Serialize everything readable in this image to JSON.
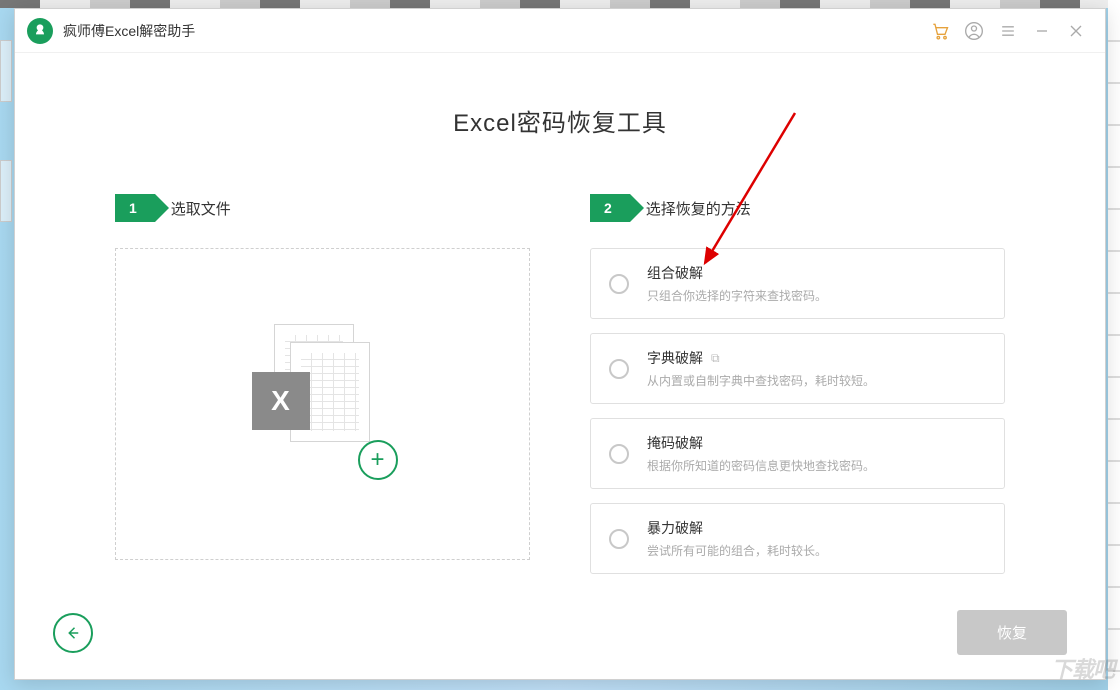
{
  "app": {
    "title": "疯师傅Excel解密助手"
  },
  "page": {
    "title": "Excel密码恢复工具"
  },
  "steps": {
    "step1": {
      "num": "1",
      "label": "选取文件"
    },
    "step2": {
      "num": "2",
      "label": "选择恢复的方法"
    }
  },
  "dropzone": {
    "x_label": "X",
    "plus": "+"
  },
  "methods": [
    {
      "title": "组合破解",
      "desc": "只组合你选择的字符来查找密码。",
      "has_icon": false
    },
    {
      "title": "字典破解",
      "desc": "从内置或自制字典中查找密码，耗时较短。",
      "has_icon": true
    },
    {
      "title": "掩码破解",
      "desc": "根据你所知道的密码信息更快地查找密码。",
      "has_icon": false
    },
    {
      "title": "暴力破解",
      "desc": "尝试所有可能的组合，耗时较长。",
      "has_icon": false
    }
  ],
  "buttons": {
    "recover": "恢复"
  },
  "watermark": "下载吧"
}
